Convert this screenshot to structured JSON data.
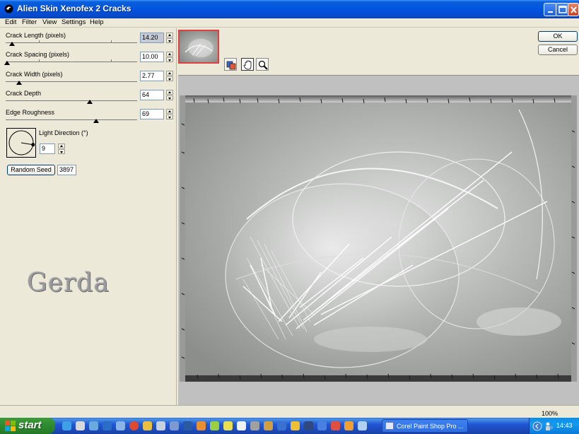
{
  "window": {
    "title": "Alien Skin Xenofex 2 Cracks"
  },
  "menu": [
    "Edit",
    "Filter",
    "View",
    "Settings",
    "Help"
  ],
  "params": [
    {
      "label": "Crack Length (pixels)",
      "value": "14.20",
      "level": 0.05,
      "selected": true
    },
    {
      "label": "Crack Spacing (pixels)",
      "value": "10.00",
      "level": 0.01,
      "selected": false
    },
    {
      "label": "Crack Width (pixels)",
      "value": "2.77",
      "level": 0.1,
      "selected": false
    },
    {
      "label": "Crack Depth",
      "value": "64",
      "level": 0.64,
      "selected": false
    },
    {
      "label": "Edge Roughness",
      "value": "69",
      "level": 0.69,
      "selected": false
    }
  ],
  "light": {
    "label": "Light Direction (°)",
    "value": "9",
    "angle_deg": 9
  },
  "seed": {
    "button_label": "Random Seed",
    "value": "3897"
  },
  "actions": {
    "ok": "OK",
    "cancel": "Cancel"
  },
  "signature": "Gerda",
  "status": {
    "zoom": "100%"
  },
  "taskbar": {
    "start": "start",
    "task_label": "Corel Paint Shop Pro ...",
    "clock": "14:43"
  },
  "colors": {
    "titlebar": "#0054e3",
    "start_green": "#2e8a2e",
    "selection_red": "#e04040",
    "panel_bg": "#ece9d8"
  }
}
